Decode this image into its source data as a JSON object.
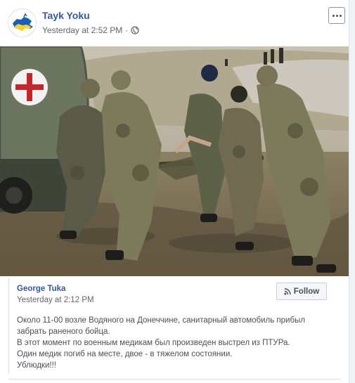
{
  "post": {
    "page_name": "Tayk Yoku",
    "timestamp": "Yesterday at 2:52 PM",
    "separator": "·"
  },
  "shared": {
    "author": "George Tuka",
    "timestamp": "Yesterday at 2:12 PM",
    "follow_label": "Follow",
    "text_lines": [
      "Около 11-00 возле Водяного на Донеччине, санитарный автомобиль прибыл",
      "забрать раненого бойца.",
      "В этот момент по военным медикам был произведен выстрел из ПТУРа.",
      "Один медик погиб на месте, двое - в тяжелом состоянии.",
      "Ублюдки!!!"
    ]
  },
  "icons": {
    "avatar": "crimea-map-avatar-icon",
    "audience": "globe-icon",
    "more": "more-options-icon",
    "follow": "rss-icon"
  },
  "colors": {
    "link_blue": "#385898",
    "meta_gray": "#606770",
    "border": "#dadde1"
  }
}
